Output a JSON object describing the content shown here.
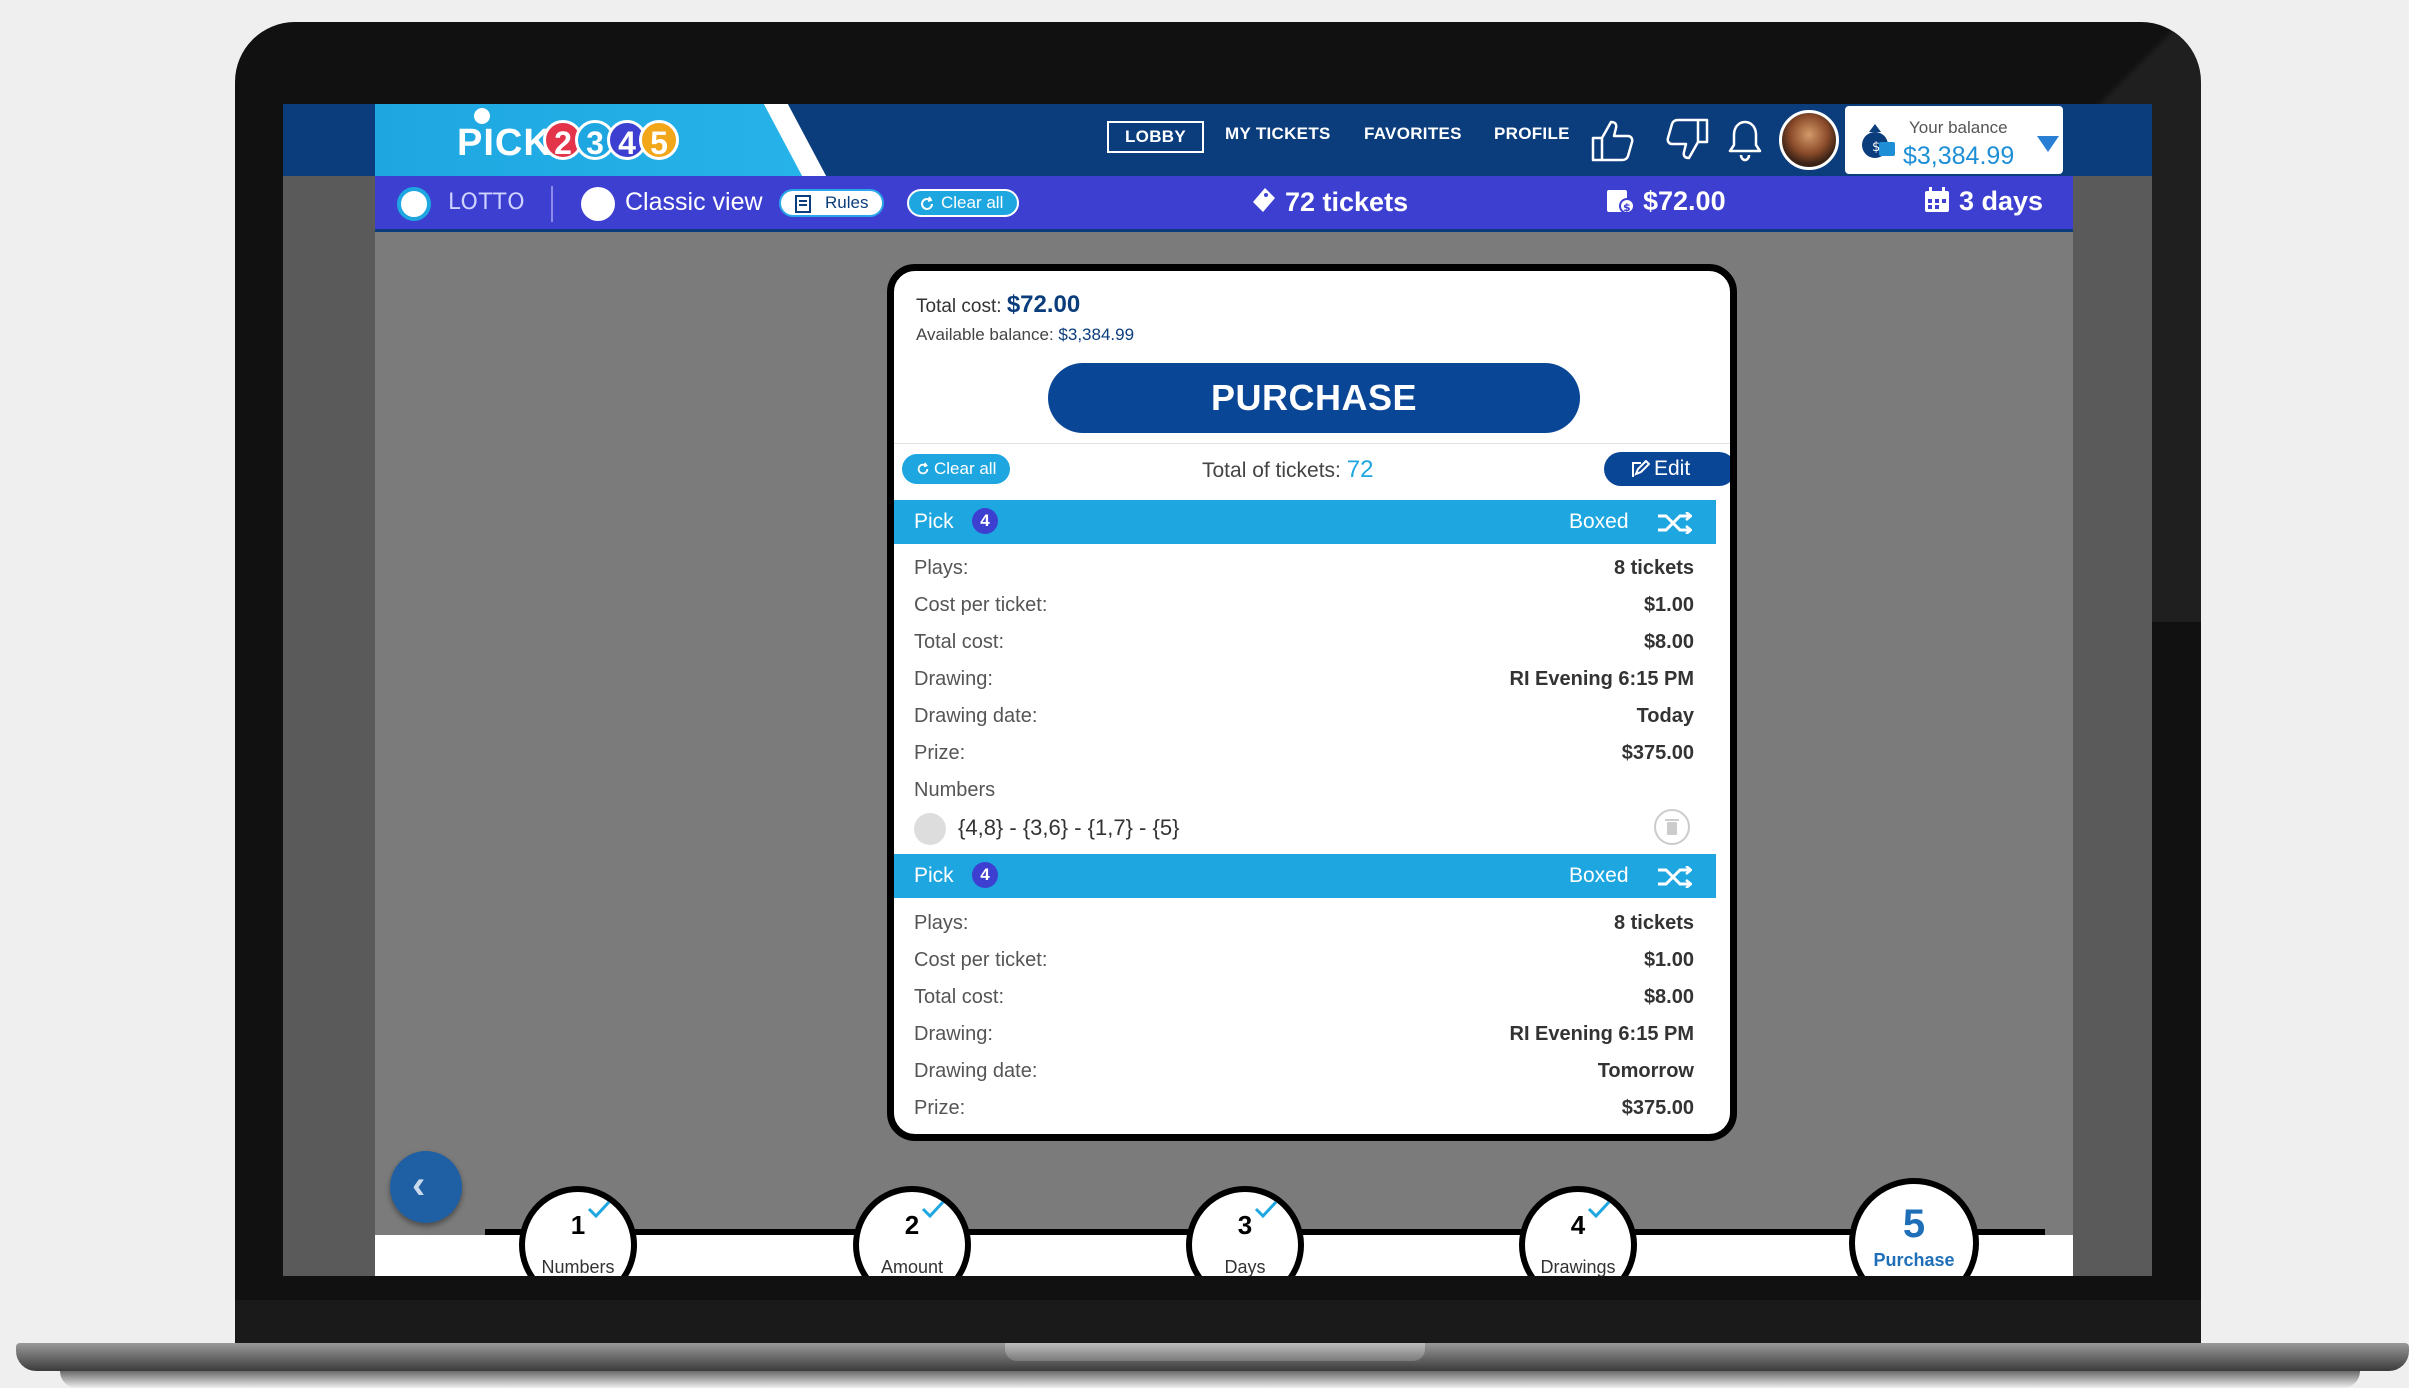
{
  "header": {
    "logo_text": "PICK",
    "logo_digits": [
      "2",
      "3",
      "4",
      "5"
    ],
    "nav": [
      {
        "label": "LOBBY",
        "active": true
      },
      {
        "label": "MY TICKETS",
        "active": false
      },
      {
        "label": "FAVORITES",
        "active": false
      },
      {
        "label": "PROFILE",
        "active": false
      }
    ],
    "balance": {
      "label": "Your balance",
      "amount": "$3,384.99"
    }
  },
  "subbar": {
    "loto_text": "LOTTO",
    "classic_view": "Classic view",
    "rules": "Rules",
    "clear_all": "Clear all",
    "tickets": "72 tickets",
    "cost": "$72.00",
    "days": "3 days"
  },
  "summary": {
    "total_cost_label": "Total cost:",
    "total_cost": "$72.00",
    "available_label": "Available balance:",
    "available": "$3,384.99",
    "purchase": "PURCHASE",
    "clear_all": "Clear all",
    "total_tickets_label": "Total of tickets:",
    "total_tickets": "72",
    "edit": "Edit"
  },
  "tickets": [
    {
      "pick_label": "Pick",
      "pick_num": "4",
      "mode": "Boxed",
      "rows": [
        {
          "k": "Plays:",
          "v": "8 tickets"
        },
        {
          "k": "Cost per ticket:",
          "v": "$1.00"
        },
        {
          "k": "Total cost:",
          "v": "$8.00"
        },
        {
          "k": "Drawing:",
          "v": "RI Evening 6:15 PM"
        },
        {
          "k": "Drawing date:",
          "v": "Today"
        },
        {
          "k": "Prize:",
          "v": "$375.00"
        }
      ],
      "numbers_label": "Numbers",
      "numbers": "{4,8} - {3,6} - {1,7} - {5}"
    },
    {
      "pick_label": "Pick",
      "pick_num": "4",
      "mode": "Boxed",
      "rows": [
        {
          "k": "Plays:",
          "v": "8 tickets"
        },
        {
          "k": "Cost per ticket:",
          "v": "$1.00"
        },
        {
          "k": "Total cost:",
          "v": "$8.00"
        },
        {
          "k": "Drawing:",
          "v": "RI Evening 6:15 PM"
        },
        {
          "k": "Drawing date:",
          "v": "Tomorrow"
        },
        {
          "k": "Prize:",
          "v": "$375.00"
        }
      ]
    }
  ],
  "stepper": [
    {
      "num": "1",
      "label": "Numbers",
      "done": true
    },
    {
      "num": "2",
      "label": "Amount",
      "done": true
    },
    {
      "num": "3",
      "label": "Days",
      "done": true
    },
    {
      "num": "4",
      "label": "Drawings",
      "done": true
    },
    {
      "num": "5",
      "label": "Purchase",
      "active": true
    }
  ],
  "colors": {
    "brand_navy": "#0b3d7c",
    "accent_blue": "#1ea6e0",
    "subbar_purple": "#3d3fd1",
    "button_blue": "#0a4696"
  }
}
